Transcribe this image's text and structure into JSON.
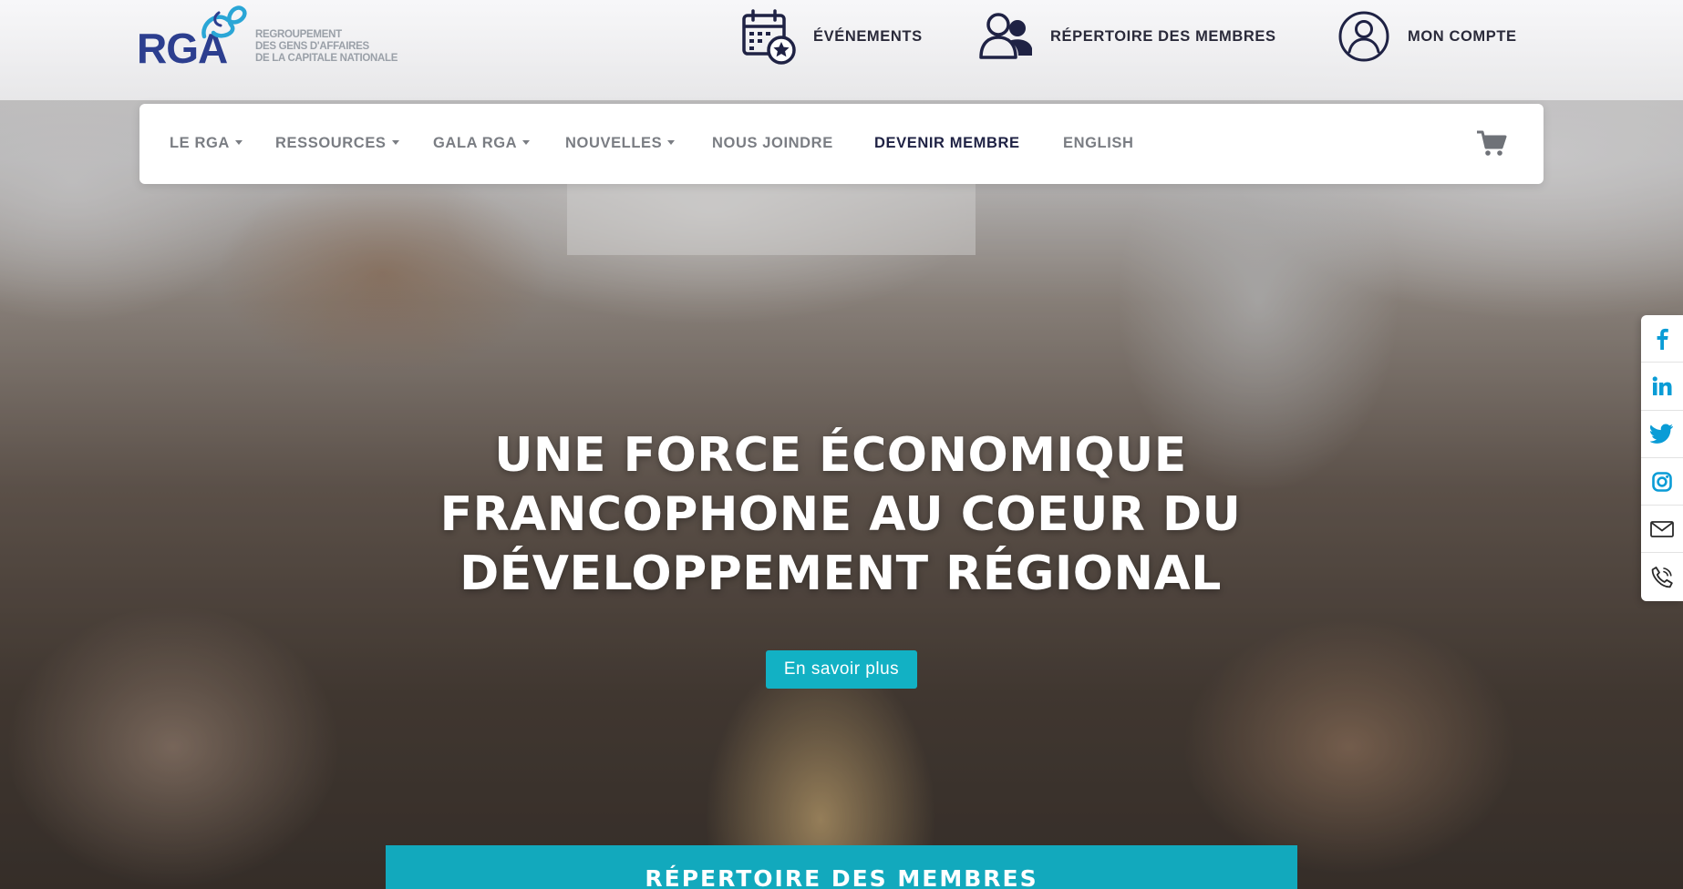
{
  "colors": {
    "accent": "#12b1c4",
    "brand_blue": "#2c3e8f",
    "nav_text": "#7a7d83",
    "nav_strong": "#1f2244"
  },
  "logo": {
    "mark": "RGA",
    "tagline": [
      "REGROUPEMENT",
      "DES GENS D'AFFAIRES",
      "DE LA CAPITALE NATIONALE"
    ]
  },
  "utility_nav": [
    {
      "label": "ÉVÉNEMENTS",
      "icon": "calendar-star-icon"
    },
    {
      "label": "RÉPERTOIRE DES MEMBRES",
      "icon": "users-icon"
    },
    {
      "label": "MON COMPTE",
      "icon": "user-circle-icon"
    }
  ],
  "main_nav": {
    "items": [
      {
        "label": "LE RGA",
        "dropdown": true
      },
      {
        "label": "RESSOURCES",
        "dropdown": true
      },
      {
        "label": "GALA RGA",
        "dropdown": true
      },
      {
        "label": "NOUVELLES",
        "dropdown": true
      },
      {
        "label": "NOUS JOINDRE",
        "dropdown": false
      },
      {
        "label": "DEVENIR MEMBRE",
        "dropdown": false
      },
      {
        "label": "ENGLISH",
        "dropdown": false
      }
    ],
    "cart_icon": "cart-icon"
  },
  "social": [
    "facebook-icon",
    "linkedin-icon",
    "twitter-icon",
    "instagram-icon",
    "mail-icon",
    "phone-icon"
  ],
  "hero": {
    "title_lines": [
      "UNE FORCE ÉCONOMIQUE",
      "FRANCOPHONE AU COEUR DU",
      "DÉVELOPPEMENT RÉGIONAL"
    ],
    "cta_label": "En savoir plus"
  },
  "directory_band": {
    "label": "RÉPERTOIRE DES MEMBRES"
  }
}
